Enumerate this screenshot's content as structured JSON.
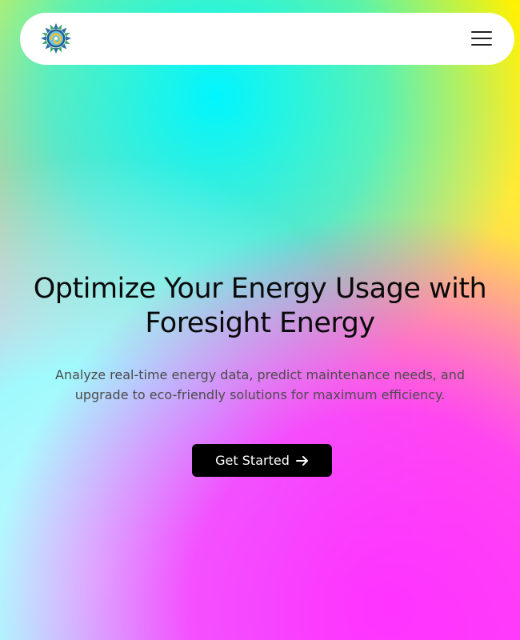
{
  "navbar": {
    "logo_icon": "sun-swirl-logo-icon",
    "menu_icon": "hamburger-menu-icon"
  },
  "hero": {
    "title": "Optimize Your Energy Usage with Foresight Energy",
    "subtitle": "Analyze real-time energy data, predict maintenance needs, and upgrade to eco-friendly solutions for maximum efficiency.",
    "cta_label": "Get Started",
    "cta_icon": "arrow-right-icon"
  },
  "colors": {
    "cta_bg": "#000000",
    "nav_bg": "#ffffff",
    "gradient_yellow": "#fff200",
    "gradient_cyan": "#00f5ff",
    "gradient_magenta": "#ff33ff"
  }
}
